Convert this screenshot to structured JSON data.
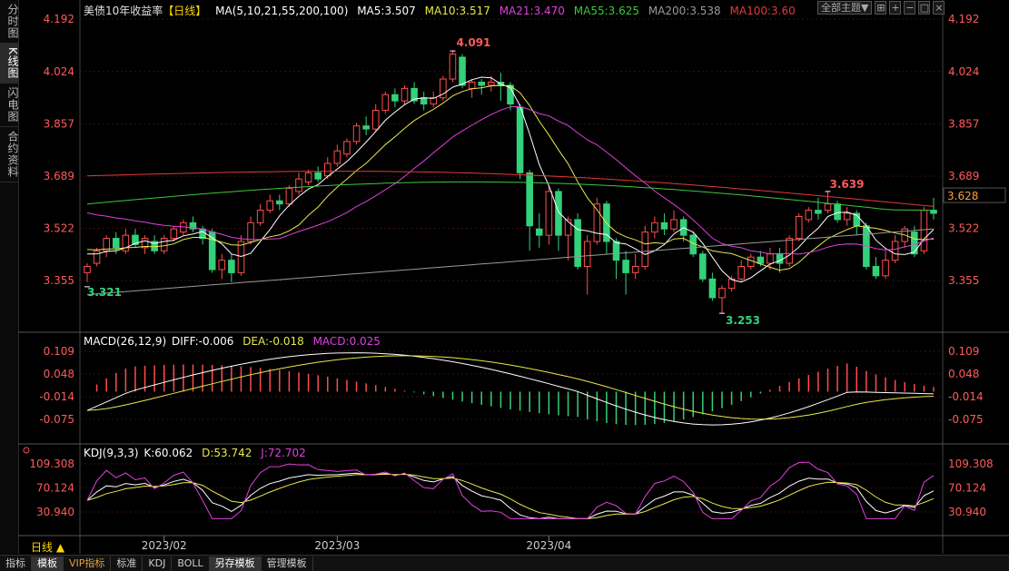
{
  "left_tabs": [
    "分时图",
    "K线图",
    "闪电图",
    "合约资料"
  ],
  "active_left_tab": "K线图",
  "header": {
    "title": "美债10年收益率",
    "period_tag": "【日线】",
    "ma_label": "MA(5,10,21,55,200,100)",
    "ma5": "MA5:3.507",
    "ma10": "MA10:3.517",
    "ma21": "MA21:3.470",
    "ma55": "MA55:3.625",
    "ma200": "MA200:3.538",
    "ma100": "MA100:3.60"
  },
  "toolbar": {
    "theme_button": "全部主题▼",
    "icon_names": [
      "grid-icon",
      "zoom-in-icon",
      "zoom-out-icon",
      "maximize-icon",
      "close-icon"
    ]
  },
  "price_axis": {
    "ticks": [
      "4.192",
      "4.024",
      "3.857",
      "3.689",
      "3.522",
      "3.355"
    ],
    "current": "3.628"
  },
  "price_annotations": {
    "high": "4.091",
    "low1": "3.321",
    "low2": "3.253",
    "peak2": "3.639"
  },
  "macd": {
    "label": "MACD(26,12,9)",
    "diff": "DIFF:-0.006",
    "dea": "DEA:-0.018",
    "macd": "MACD:0.025",
    "ticks": [
      "0.109",
      "0.048",
      "-0.014",
      "-0.075"
    ]
  },
  "kdj": {
    "label": "KDJ(9,3,3)",
    "k": "K:60.062",
    "d": "D:53.742",
    "j": "J:72.702",
    "ticks": [
      "109.308",
      "70.124",
      "30.940"
    ]
  },
  "x_axis": {
    "labels": [
      "2023/02",
      "2023/03",
      "2023/04"
    ]
  },
  "period_label": "日线 ▲",
  "bottom_tabs": [
    "指标",
    "模板",
    "VIP指标",
    "标准",
    "KDJ",
    "BOLL",
    "另存模板",
    "管理模板"
  ],
  "colors": {
    "up": "#ff4d4d",
    "down": "#33d17a",
    "ma5": "#ffffff",
    "ma10": "#e8e84a",
    "ma21": "#e040e0",
    "ma55": "#3cc83c",
    "ma200": "#9a9a9a",
    "ma100": "#e03a3a",
    "axis_text": "#ff5a5a"
  }
}
